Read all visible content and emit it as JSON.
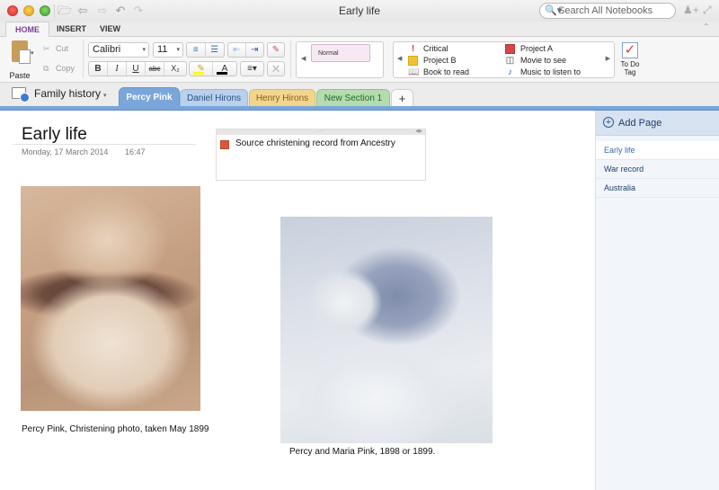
{
  "window": {
    "title": "Early life",
    "search_placeholder": "Search All Notebooks"
  },
  "toolbar_icons": [
    "folder-icon",
    "back-icon",
    "forward-icon",
    "undo-icon",
    "redo-icon"
  ],
  "ribbon_tabs": [
    {
      "label": "HOME",
      "active": true
    },
    {
      "label": "INSERT",
      "active": false
    },
    {
      "label": "VIEW",
      "active": false
    }
  ],
  "ribbon": {
    "paste_label": "Paste",
    "cut_label": "Cut",
    "copy_label": "Copy",
    "font_name": "Calibri",
    "font_size": "11",
    "bold": "B",
    "italic": "I",
    "underline": "U",
    "strikethrough": "abc",
    "subscript": "X₂",
    "style_normal": "Normal",
    "highlight_color": "#ffff00",
    "font_color": "#000000",
    "tags": [
      {
        "label": "Critical",
        "icon": "exclamation-icon",
        "color": "#e0302a"
      },
      {
        "label": "Project B",
        "icon": "square-icon",
        "color": "#f1c232"
      },
      {
        "label": "Book to read",
        "icon": "book-icon",
        "color": "#2f5a9e"
      },
      {
        "label": "Project A",
        "icon": "square-icon",
        "color": "#d04848"
      },
      {
        "label": "Movie to see",
        "icon": "film-icon",
        "color": "#444444"
      },
      {
        "label": "Music to listen to",
        "icon": "music-note-icon",
        "color": "#2a5fbf"
      }
    ],
    "todo_tag_label_1": "To Do",
    "todo_tag_label_2": "Tag"
  },
  "notebook": {
    "name": "Family history",
    "sections": [
      {
        "label": "Percy Pink",
        "active": true,
        "color": "#7aa6da"
      },
      {
        "label": "Daniel Hirons",
        "active": false,
        "color": "#b9d1ec"
      },
      {
        "label": "Henry Hirons",
        "active": false,
        "color": "#f2d690"
      },
      {
        "label": "New Section 1",
        "active": false,
        "color": "#b5dbb0"
      }
    ],
    "add_section_label": "+"
  },
  "page": {
    "title": "Early life",
    "date": "Monday, 17 March 2014",
    "time": "16:47",
    "note_text": "Source christening record from Ancestry",
    "note_tag_color": "#d55a3c",
    "photos": [
      {
        "name": "christening-photo",
        "caption": "Percy Pink, Christening photo, taken May 1899"
      },
      {
        "name": "percy-maria-photo",
        "caption": "Percy and Maria Pink, 1898 or 1899."
      }
    ]
  },
  "page_list": {
    "add_page_label": "Add Page",
    "pages": [
      {
        "label": "Early life",
        "active": true
      },
      {
        "label": "War record",
        "active": false
      },
      {
        "label": "Australia",
        "active": false
      }
    ]
  }
}
